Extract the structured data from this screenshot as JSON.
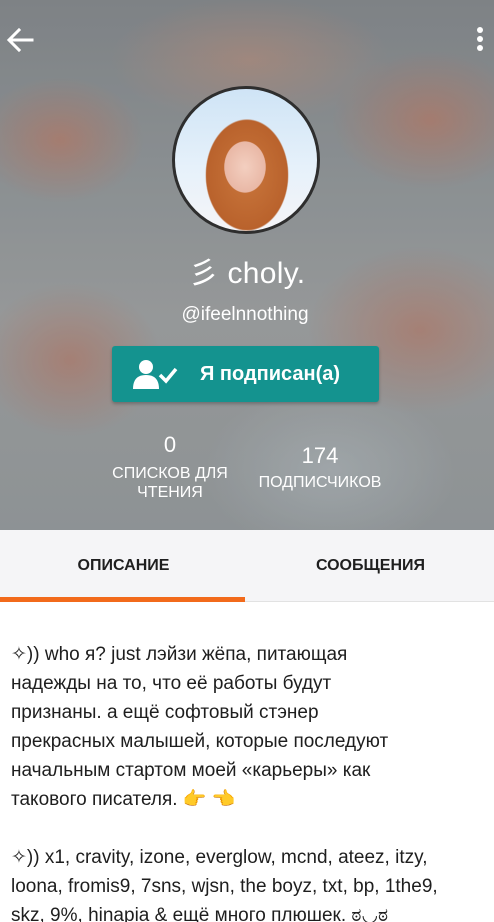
{
  "header": {
    "back_icon": "arrow-left-icon",
    "more_icon": "more-vertical-icon"
  },
  "profile": {
    "name": "彡 choly.",
    "handle": "@ifeelnnothing",
    "follow_button_label": "Я подписан(а)",
    "follow_icon": "user-check-icon",
    "stats": {
      "reading_lists_value": "0",
      "reading_lists_label": "списков для\nчтения",
      "followers_value": "174",
      "followers_label": "подписчиков"
    }
  },
  "tabs": [
    {
      "label": "ОПИСАНИЕ",
      "active": true
    },
    {
      "label": "СООБЩЕНИЯ",
      "active": false
    }
  ],
  "bio": {
    "paragraph1": "✧)) who я? just лэйзи жёпа, питающая\nнадежды на то, что её работы будут\nпризнаны. а ещё софтовый стэнер\nпрекрасных малышей, которые последуют\nначальным стартом моей «карьеры» как\nтакового писателя. 👉 👈",
    "paragraph2": "✧)) x1, cravity, izone, everglow, mcnd, ateez, itzy,\nloona, fromis9, 7sns, wjsn, the boyz, txt, bp, 1the9,\nskz, 9%, hinapia & ещё много плюшек. ಠ◡ಠ"
  },
  "colors": {
    "accent_teal": "#14938f",
    "tab_indicator_orange": "#f26a1b"
  }
}
